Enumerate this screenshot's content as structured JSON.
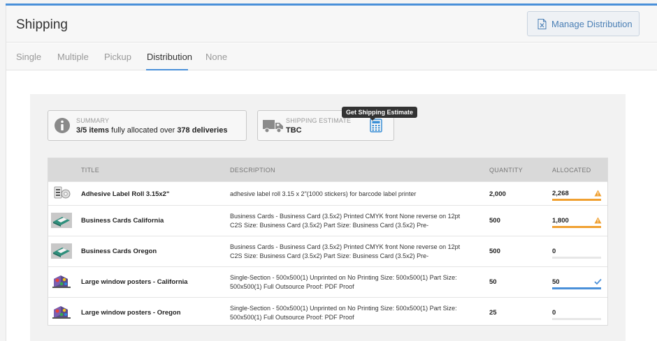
{
  "header": {
    "title": "Shipping",
    "manage_label": "Manage Distribution"
  },
  "tabs": [
    {
      "label": "Single",
      "active": false
    },
    {
      "label": "Multiple",
      "active": false
    },
    {
      "label": "Pickup",
      "active": false
    },
    {
      "label": "Distribution",
      "active": true
    },
    {
      "label": "None",
      "active": false
    }
  ],
  "summary": {
    "label": "SUMMARY",
    "items": "3/5 items",
    "mid": " fully allocated over ",
    "deliveries": "378 deliveries",
    "icon": "info-circle-icon"
  },
  "estimate": {
    "label": "SHIPPING ESTIMATE",
    "value": "TBC",
    "tooltip": "Get Shipping Estimate",
    "icon": "truck-icon",
    "calc_icon": "calculator-icon"
  },
  "table": {
    "headers": {
      "title": "TITLE",
      "description": "DESCRIPTION",
      "quantity": "QUANTITY",
      "allocated": "ALLOCATED"
    },
    "rows": [
      {
        "title": "Adhesive Label Roll 3.15x2\"",
        "description": "adhesive label roll 3.15 x 2\"(1000 stickers) for barcode label printer",
        "quantity": "2,000",
        "allocated": "2,268",
        "status": "warning",
        "fill": 100,
        "color": "#f0a030"
      },
      {
        "title": "Business Cards California",
        "description": "Business Cards - Business Card (3.5x2) Printed CMYK front None reverse on 12pt C2S Size: Business Card (3.5x2) Part Size: Business Card (3.5x2) Pre-",
        "quantity": "500",
        "allocated": "1,800",
        "status": "warning",
        "fill": 100,
        "color": "#f0a030"
      },
      {
        "title": "Business Cards Oregon",
        "description": "Business Cards - Business Card (3.5x2) Printed CMYK front None reverse on 12pt C2S Size: Business Card (3.5x2) Part Size: Business Card (3.5x2) Pre-",
        "quantity": "500",
        "allocated": "0",
        "status": "none",
        "fill": 0,
        "color": "#e7e7e7"
      },
      {
        "title": "Large window posters - California",
        "description": "Single-Section - 500x500(1) Unprinted on No Printing Size: 500x500(1) Part Size: 500x500(1) Full Outsource Proof: PDF Proof",
        "quantity": "50",
        "allocated": "50",
        "status": "ok",
        "fill": 100,
        "color": "#4a90d9"
      },
      {
        "title": "Large window posters - Oregon",
        "description": "Single-Section - 500x500(1) Unprinted on No Printing Size: 500x500(1) Part Size: 500x500(1) Full Outsource Proof: PDF Proof",
        "quantity": "25",
        "allocated": "0",
        "status": "none",
        "fill": 0,
        "color": "#e7e7e7"
      }
    ]
  }
}
